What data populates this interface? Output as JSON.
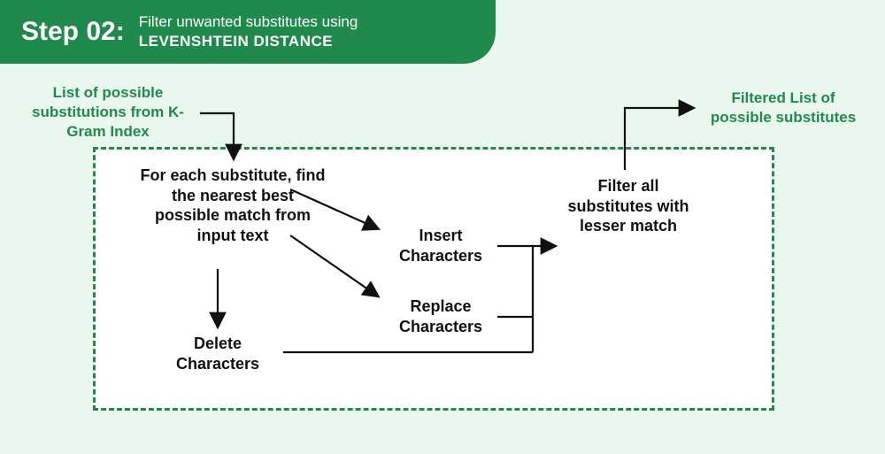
{
  "header": {
    "step_label": "Step 02:",
    "subtitle_line1": "Filter unwanted substitutes using",
    "subtitle_line2": "LEVENSHTEIN DISTANCE"
  },
  "input_label": "List of possible substitutions from K-Gram Index",
  "output_label": "Filtered List of possible substitutes",
  "nodes": {
    "main": "For each substitute, find the nearest best possible match from input text",
    "insert": "Insert Characters",
    "replace": "Replace Characters",
    "delete": "Delete Characters",
    "filter": "Filter all substitutes with lesser match"
  }
}
